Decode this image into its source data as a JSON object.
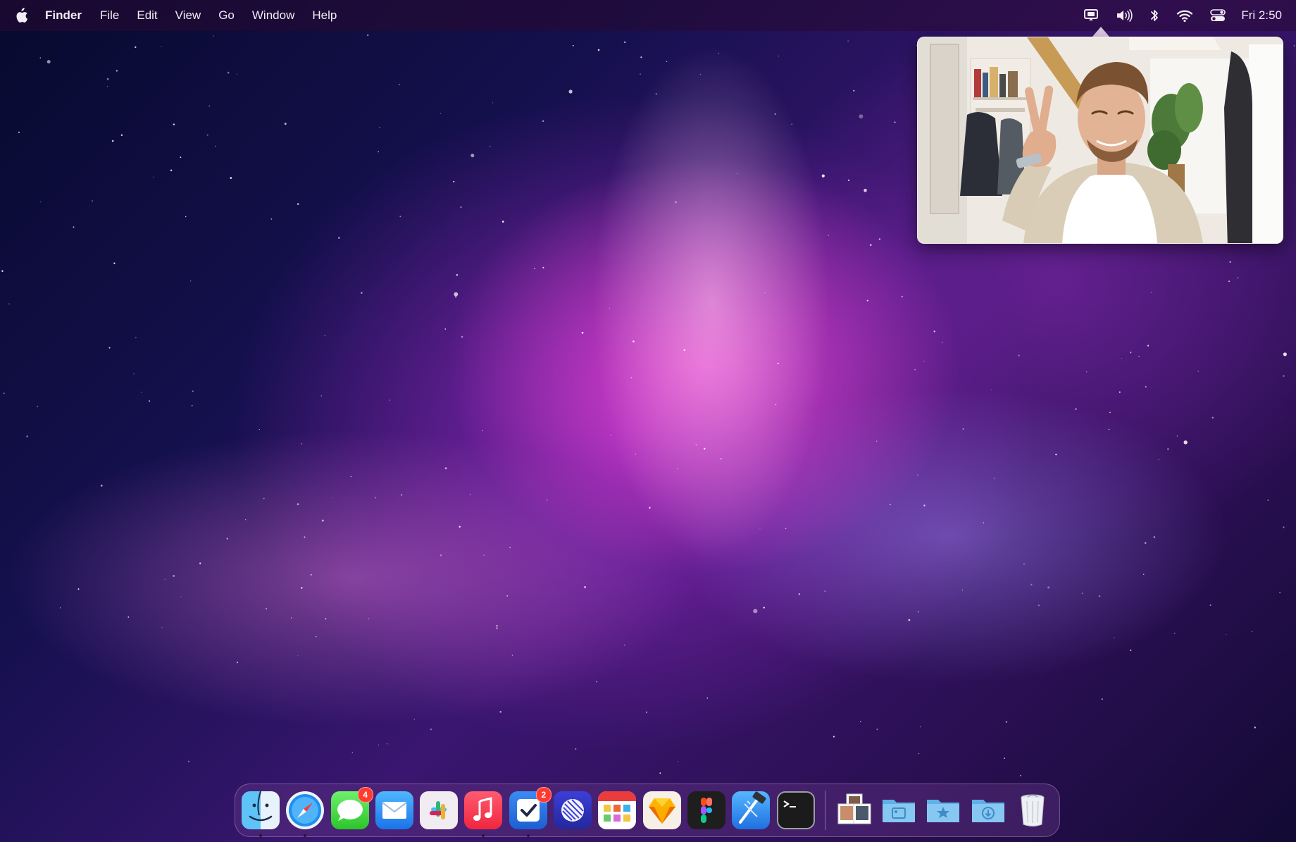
{
  "menubar": {
    "apple_icon": "apple-logo-icon",
    "app_name": "Finder",
    "menus": [
      "File",
      "Edit",
      "View",
      "Go",
      "Window",
      "Help"
    ],
    "status_icons": [
      "screen-sharing-icon",
      "volume-icon",
      "bluetooth-icon",
      "wifi-icon",
      "control-center-icon"
    ],
    "clock": "Fri 2:50"
  },
  "pip_window": {
    "content": "facetime-video",
    "accent": "#f5ecf6"
  },
  "dock": {
    "apps": [
      {
        "name": "Finder",
        "icon": "finder-icon",
        "running": true,
        "badge": ""
      },
      {
        "name": "Safari",
        "icon": "safari-icon",
        "running": true,
        "badge": ""
      },
      {
        "name": "Messages",
        "icon": "messages-icon",
        "running": false,
        "badge": "4"
      },
      {
        "name": "Mail",
        "icon": "mail-icon",
        "running": false,
        "badge": ""
      },
      {
        "name": "Slack",
        "icon": "slack-icon",
        "running": false,
        "badge": ""
      },
      {
        "name": "Music",
        "icon": "music-icon",
        "running": true,
        "badge": ""
      },
      {
        "name": "Things",
        "icon": "things-icon",
        "running": true,
        "badge": "2"
      },
      {
        "name": "Linear",
        "icon": "linear-icon",
        "running": false,
        "badge": ""
      },
      {
        "name": "Fantastical",
        "icon": "calendar-grid-icon",
        "running": false,
        "badge": ""
      },
      {
        "name": "Sketch",
        "icon": "sketch-icon",
        "running": false,
        "badge": ""
      },
      {
        "name": "Figma",
        "icon": "figma-icon",
        "running": false,
        "badge": ""
      },
      {
        "name": "Xcode",
        "icon": "xcode-icon",
        "running": false,
        "badge": ""
      },
      {
        "name": "Terminal",
        "icon": "terminal-icon",
        "running": false,
        "badge": ""
      }
    ],
    "stacks": [
      {
        "name": "Photo stack",
        "icon": "photo-stack-icon"
      },
      {
        "name": "Pictures",
        "icon": "pictures-folder-icon"
      },
      {
        "name": "Applications",
        "icon": "applications-folder-icon"
      },
      {
        "name": "Downloads",
        "icon": "downloads-folder-icon"
      },
      {
        "name": "Trash",
        "icon": "trash-icon"
      }
    ],
    "colors": {
      "badge": "#ff3b30",
      "background": "#5f3282"
    }
  }
}
